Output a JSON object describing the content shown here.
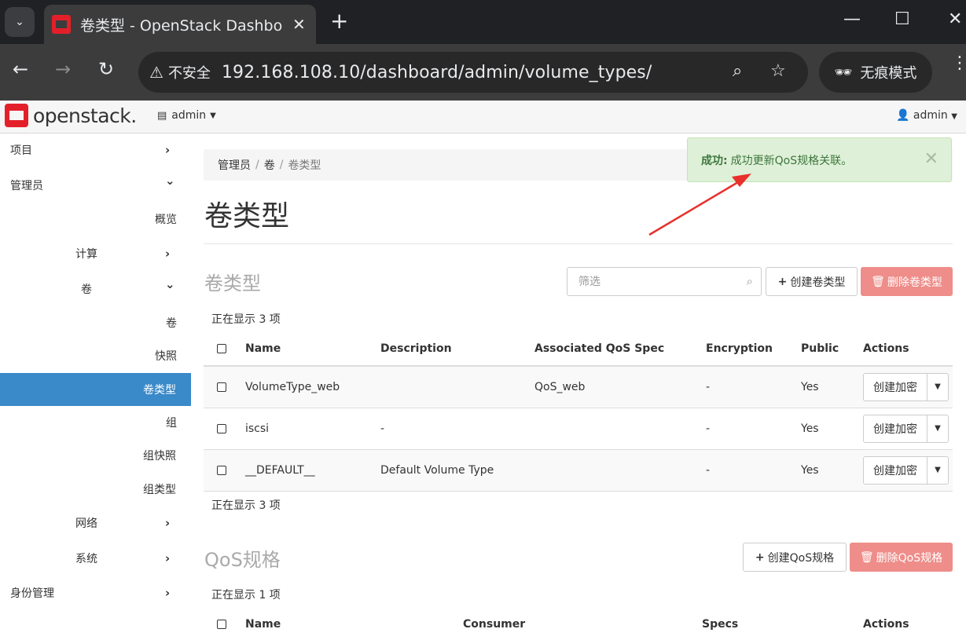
{
  "browser": {
    "tab_title": "卷类型 - OpenStack Dashboard",
    "tab_close": "✕",
    "new_tab": "+",
    "insecure_label": "不安全",
    "url": "192.168.108.10/dashboard/admin/volume_types/",
    "incognito_label": "无痕模式"
  },
  "header": {
    "logo_text": "openstack.",
    "project_label": "admin",
    "user_label": "admin"
  },
  "sidebar": {
    "items": [
      {
        "label": "项目",
        "chevron": "›"
      },
      {
        "label": "管理员",
        "chevron": "⌄"
      },
      {
        "label": "概览"
      },
      {
        "label": "计算",
        "chevron": "›"
      },
      {
        "label": "卷",
        "chevron": "⌄"
      },
      {
        "label": "卷"
      },
      {
        "label": "快照"
      },
      {
        "label": "卷类型"
      },
      {
        "label": "组"
      },
      {
        "label": "组快照"
      },
      {
        "label": "组类型"
      },
      {
        "label": "网络",
        "chevron": "›"
      },
      {
        "label": "系统",
        "chevron": "›"
      },
      {
        "label": "身份管理",
        "chevron": "›"
      }
    ]
  },
  "breadcrumb": [
    "管理员",
    "卷",
    "卷类型"
  ],
  "page_title": "卷类型",
  "volume_types": {
    "section_title": "卷类型",
    "filter_placeholder": "筛选",
    "create_label": "创建卷类型",
    "delete_label": "删除卷类型",
    "count_text": "正在显示 3 项",
    "columns": [
      "Name",
      "Description",
      "Associated QoS Spec",
      "Encryption",
      "Public",
      "Actions"
    ],
    "rows": [
      {
        "name": "VolumeType_web",
        "description": "",
        "qos": "QoS_web",
        "encryption": "-",
        "public": "Yes",
        "action": "创建加密"
      },
      {
        "name": "iscsi",
        "description": "-",
        "qos": "",
        "encryption": "-",
        "public": "Yes",
        "action": "创建加密"
      },
      {
        "name": "__DEFAULT__",
        "description": "Default Volume Type",
        "qos": "",
        "encryption": "-",
        "public": "Yes",
        "action": "创建加密"
      }
    ]
  },
  "qos": {
    "section_title": "QoS规格",
    "create_label": "创建QoS规格",
    "delete_label": "删除QoS规格",
    "count_text": "正在显示 1 项",
    "columns": [
      "Name",
      "Consumer",
      "Specs",
      "Actions"
    ]
  },
  "toast": {
    "title": "成功:",
    "message": "成功更新QoS规格关联。",
    "close": "✕"
  },
  "colors": {
    "accent": "#3a89c9",
    "danger_button": "#ee8d89",
    "toast_bg": "#dff0d8",
    "annotation_arrow": "#e8302c"
  }
}
